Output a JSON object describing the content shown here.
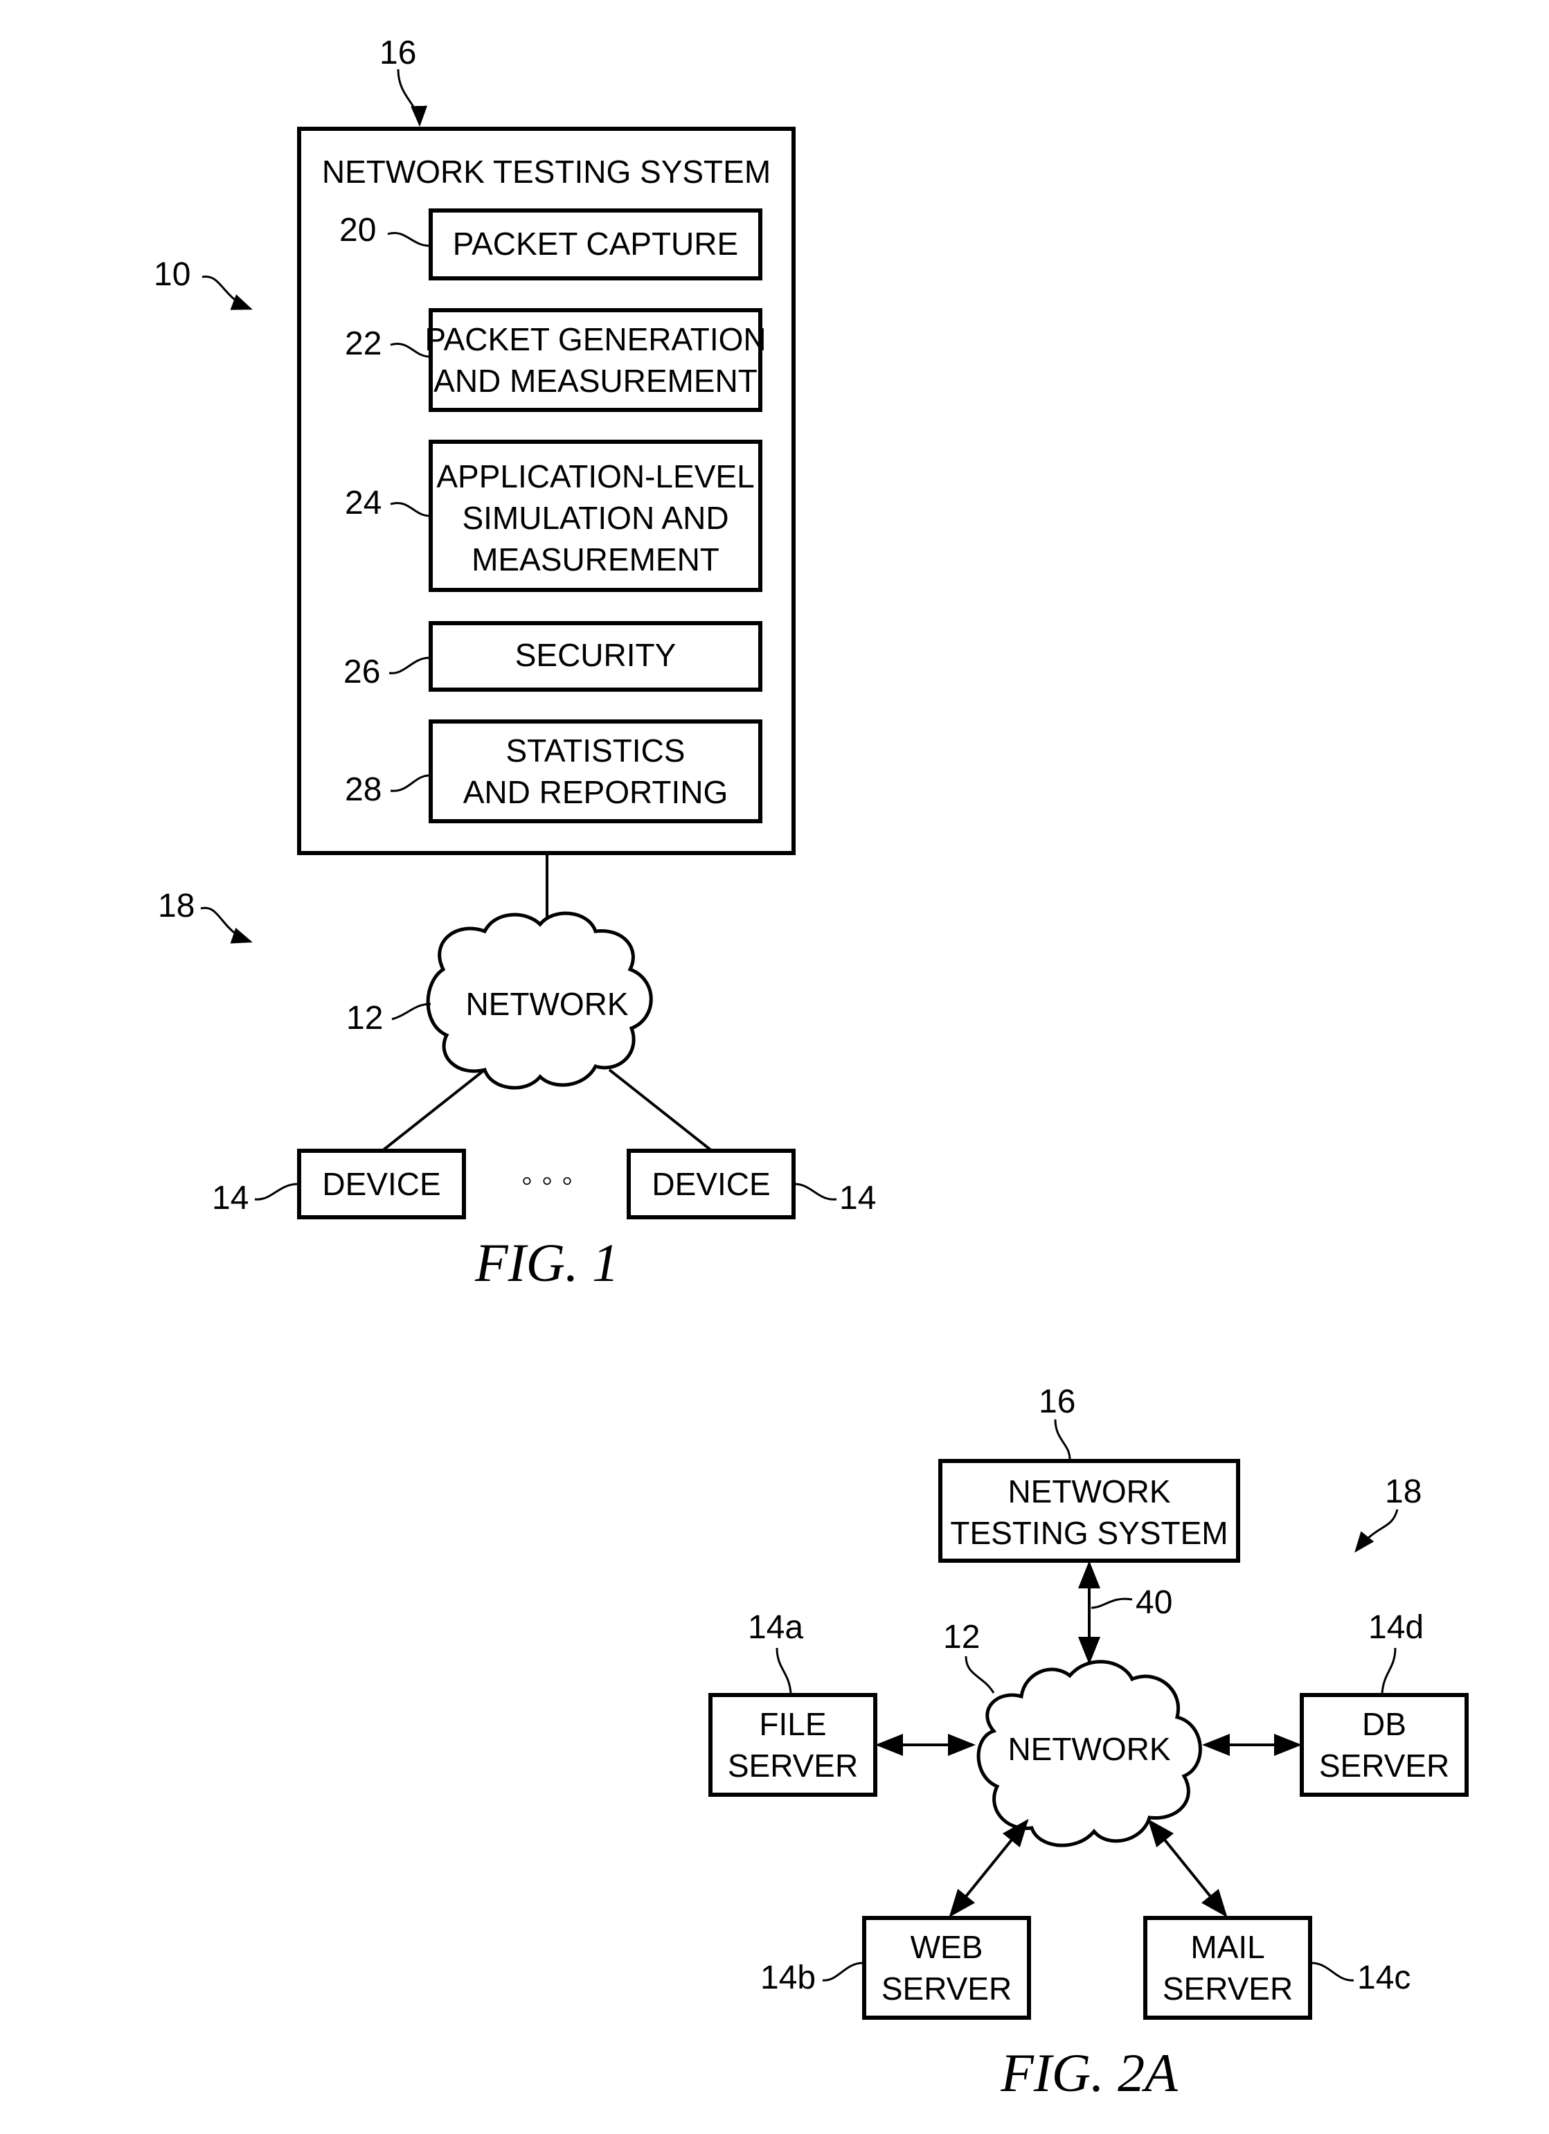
{
  "fig1": {
    "caption": "FIG. 1",
    "system_ref": "16",
    "diagram_ref": "10",
    "env_ref": "18",
    "system_title": "NETWORK TESTING SYSTEM",
    "modules": [
      {
        "ref": "20",
        "lines": [
          "PACKET CAPTURE"
        ]
      },
      {
        "ref": "22",
        "lines": [
          "PACKET GENERATION",
          "AND MEASUREMENT"
        ]
      },
      {
        "ref": "24",
        "lines": [
          "APPLICATION-LEVEL",
          "SIMULATION AND",
          "MEASUREMENT"
        ]
      },
      {
        "ref": "26",
        "lines": [
          "SECURITY"
        ]
      },
      {
        "ref": "28",
        "lines": [
          "STATISTICS",
          "AND REPORTING"
        ]
      }
    ],
    "network": {
      "ref": "12",
      "label": "NETWORK"
    },
    "devices": [
      {
        "ref": "14",
        "label": "DEVICE"
      },
      {
        "ref": "14",
        "label": "DEVICE"
      }
    ],
    "ellipsis": "◦ ◦ ◦"
  },
  "fig2a": {
    "caption": "FIG. 2A",
    "system_ref": "16",
    "env_ref": "18",
    "system_lines": [
      "NETWORK",
      "TESTING SYSTEM"
    ],
    "link_ref": "40",
    "network": {
      "ref": "12",
      "label": "NETWORK"
    },
    "servers": [
      {
        "ref": "14a",
        "lines": [
          "FILE",
          "SERVER"
        ]
      },
      {
        "ref": "14b",
        "lines": [
          "WEB",
          "SERVER"
        ]
      },
      {
        "ref": "14c",
        "lines": [
          "MAIL",
          "SERVER"
        ]
      },
      {
        "ref": "14d",
        "lines": [
          "DB",
          "SERVER"
        ]
      }
    ]
  }
}
